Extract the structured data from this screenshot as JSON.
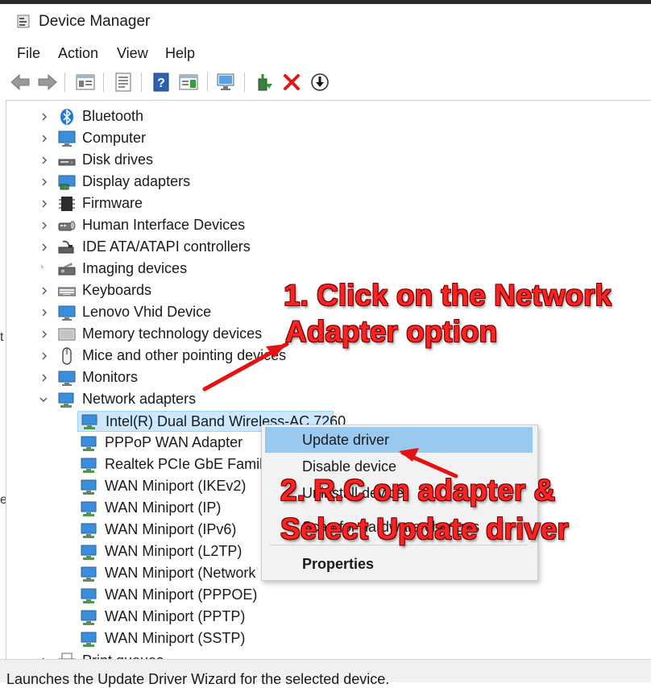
{
  "window": {
    "title": "Device Manager"
  },
  "menu": [
    "File",
    "Action",
    "View",
    "Help"
  ],
  "toolbar": {
    "buttons": [
      "back-icon",
      "forward-icon",
      "properties-view-icon",
      "show-hide-icon",
      "help-icon",
      "action-pane-icon",
      "scan-hardware-icon",
      "enable-driver-icon",
      "uninstall-icon",
      "update-driver-icon"
    ]
  },
  "tree": {
    "categories": [
      {
        "label": "Bluetooth",
        "icon": "bluetooth-icon"
      },
      {
        "label": "Computer",
        "icon": "computer-icon"
      },
      {
        "label": "Disk drives",
        "icon": "disk-drive-icon"
      },
      {
        "label": "Display adapters",
        "icon": "display-adapter-icon"
      },
      {
        "label": "Firmware",
        "icon": "firmware-icon"
      },
      {
        "label": "Human Interface Devices",
        "icon": "hid-icon"
      },
      {
        "label": "IDE ATA/ATAPI controllers",
        "icon": "ide-controller-icon"
      },
      {
        "label": "Imaging devices",
        "icon": "camera-icon"
      },
      {
        "label": "Keyboards",
        "icon": "keyboard-icon"
      },
      {
        "label": "Lenovo Vhid Device",
        "icon": "monitor-icon"
      },
      {
        "label": "Memory technology devices",
        "icon": "memory-icon"
      },
      {
        "label": "Mice and other pointing devices",
        "icon": "mouse-icon"
      },
      {
        "label": "Monitors",
        "icon": "monitor-icon"
      },
      {
        "label": "Network adapters",
        "icon": "network-adapter-icon"
      }
    ],
    "network_children": [
      "Intel(R) Dual Band Wireless-AC 7260",
      "PPPoP WAN Adapter",
      "Realtek PCIe GbE Family",
      "WAN Miniport (IKEv2)",
      "WAN Miniport (IP)",
      "WAN Miniport (IPv6)",
      "WAN Miniport (L2TP)",
      "WAN Miniport (Network",
      "WAN Miniport (PPPOE)",
      "WAN Miniport (PPTP)",
      "WAN Miniport (SSTP)"
    ],
    "partial_next": "Print queues"
  },
  "context_menu": {
    "update": "Update driver",
    "disable": "Disable device",
    "uninstall": "Uninstall device",
    "scan": "Scan for hardware changes",
    "properties": "Properties"
  },
  "annotations": {
    "step1_line1": "1. Click on the Network",
    "step1_line2": "Adapter option",
    "step2_line1": "2. R.C on adapter &",
    "step2_line2": "Select Update driver",
    "arrow_color": "#ee1111"
  },
  "status": {
    "text": "Launches the Update Driver Wizard for the selected device."
  }
}
